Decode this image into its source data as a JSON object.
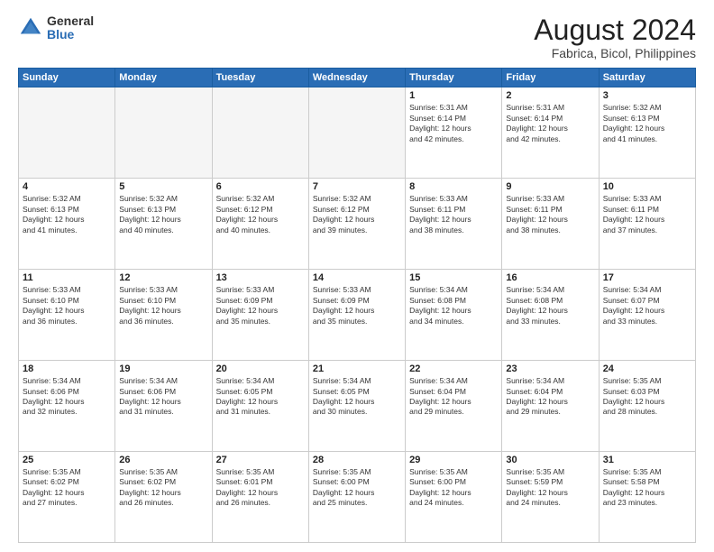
{
  "logo": {
    "general": "General",
    "blue": "Blue"
  },
  "title": "August 2024",
  "subtitle": "Fabrica, Bicol, Philippines",
  "days_of_week": [
    "Sunday",
    "Monday",
    "Tuesday",
    "Wednesday",
    "Thursday",
    "Friday",
    "Saturday"
  ],
  "weeks": [
    [
      {
        "day": "",
        "info": ""
      },
      {
        "day": "",
        "info": ""
      },
      {
        "day": "",
        "info": ""
      },
      {
        "day": "",
        "info": ""
      },
      {
        "day": "1",
        "info": "Sunrise: 5:31 AM\nSunset: 6:14 PM\nDaylight: 12 hours\nand 42 minutes."
      },
      {
        "day": "2",
        "info": "Sunrise: 5:31 AM\nSunset: 6:14 PM\nDaylight: 12 hours\nand 42 minutes."
      },
      {
        "day": "3",
        "info": "Sunrise: 5:32 AM\nSunset: 6:13 PM\nDaylight: 12 hours\nand 41 minutes."
      }
    ],
    [
      {
        "day": "4",
        "info": "Sunrise: 5:32 AM\nSunset: 6:13 PM\nDaylight: 12 hours\nand 41 minutes."
      },
      {
        "day": "5",
        "info": "Sunrise: 5:32 AM\nSunset: 6:13 PM\nDaylight: 12 hours\nand 40 minutes."
      },
      {
        "day": "6",
        "info": "Sunrise: 5:32 AM\nSunset: 6:12 PM\nDaylight: 12 hours\nand 40 minutes."
      },
      {
        "day": "7",
        "info": "Sunrise: 5:32 AM\nSunset: 6:12 PM\nDaylight: 12 hours\nand 39 minutes."
      },
      {
        "day": "8",
        "info": "Sunrise: 5:33 AM\nSunset: 6:11 PM\nDaylight: 12 hours\nand 38 minutes."
      },
      {
        "day": "9",
        "info": "Sunrise: 5:33 AM\nSunset: 6:11 PM\nDaylight: 12 hours\nand 38 minutes."
      },
      {
        "day": "10",
        "info": "Sunrise: 5:33 AM\nSunset: 6:11 PM\nDaylight: 12 hours\nand 37 minutes."
      }
    ],
    [
      {
        "day": "11",
        "info": "Sunrise: 5:33 AM\nSunset: 6:10 PM\nDaylight: 12 hours\nand 36 minutes."
      },
      {
        "day": "12",
        "info": "Sunrise: 5:33 AM\nSunset: 6:10 PM\nDaylight: 12 hours\nand 36 minutes."
      },
      {
        "day": "13",
        "info": "Sunrise: 5:33 AM\nSunset: 6:09 PM\nDaylight: 12 hours\nand 35 minutes."
      },
      {
        "day": "14",
        "info": "Sunrise: 5:33 AM\nSunset: 6:09 PM\nDaylight: 12 hours\nand 35 minutes."
      },
      {
        "day": "15",
        "info": "Sunrise: 5:34 AM\nSunset: 6:08 PM\nDaylight: 12 hours\nand 34 minutes."
      },
      {
        "day": "16",
        "info": "Sunrise: 5:34 AM\nSunset: 6:08 PM\nDaylight: 12 hours\nand 33 minutes."
      },
      {
        "day": "17",
        "info": "Sunrise: 5:34 AM\nSunset: 6:07 PM\nDaylight: 12 hours\nand 33 minutes."
      }
    ],
    [
      {
        "day": "18",
        "info": "Sunrise: 5:34 AM\nSunset: 6:06 PM\nDaylight: 12 hours\nand 32 minutes."
      },
      {
        "day": "19",
        "info": "Sunrise: 5:34 AM\nSunset: 6:06 PM\nDaylight: 12 hours\nand 31 minutes."
      },
      {
        "day": "20",
        "info": "Sunrise: 5:34 AM\nSunset: 6:05 PM\nDaylight: 12 hours\nand 31 minutes."
      },
      {
        "day": "21",
        "info": "Sunrise: 5:34 AM\nSunset: 6:05 PM\nDaylight: 12 hours\nand 30 minutes."
      },
      {
        "day": "22",
        "info": "Sunrise: 5:34 AM\nSunset: 6:04 PM\nDaylight: 12 hours\nand 29 minutes."
      },
      {
        "day": "23",
        "info": "Sunrise: 5:34 AM\nSunset: 6:04 PM\nDaylight: 12 hours\nand 29 minutes."
      },
      {
        "day": "24",
        "info": "Sunrise: 5:35 AM\nSunset: 6:03 PM\nDaylight: 12 hours\nand 28 minutes."
      }
    ],
    [
      {
        "day": "25",
        "info": "Sunrise: 5:35 AM\nSunset: 6:02 PM\nDaylight: 12 hours\nand 27 minutes."
      },
      {
        "day": "26",
        "info": "Sunrise: 5:35 AM\nSunset: 6:02 PM\nDaylight: 12 hours\nand 26 minutes."
      },
      {
        "day": "27",
        "info": "Sunrise: 5:35 AM\nSunset: 6:01 PM\nDaylight: 12 hours\nand 26 minutes."
      },
      {
        "day": "28",
        "info": "Sunrise: 5:35 AM\nSunset: 6:00 PM\nDaylight: 12 hours\nand 25 minutes."
      },
      {
        "day": "29",
        "info": "Sunrise: 5:35 AM\nSunset: 6:00 PM\nDaylight: 12 hours\nand 24 minutes."
      },
      {
        "day": "30",
        "info": "Sunrise: 5:35 AM\nSunset: 5:59 PM\nDaylight: 12 hours\nand 24 minutes."
      },
      {
        "day": "31",
        "info": "Sunrise: 5:35 AM\nSunset: 5:58 PM\nDaylight: 12 hours\nand 23 minutes."
      }
    ]
  ]
}
